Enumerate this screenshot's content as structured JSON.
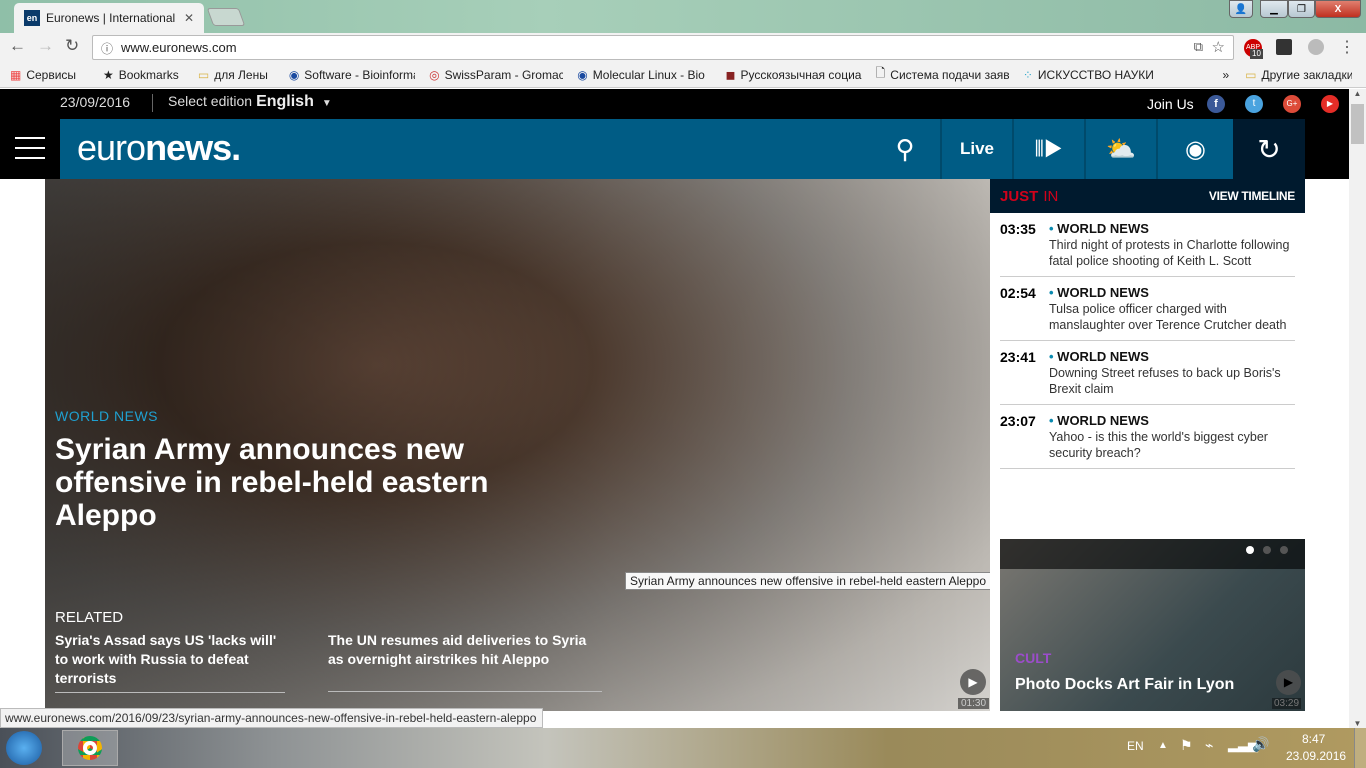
{
  "browser": {
    "tab_title": "Euronews | International",
    "tab_favicon": "en",
    "url": "www.euronews.com",
    "bookmarks": [
      {
        "icon": "apps",
        "label": "Сервисы"
      },
      {
        "icon": "star",
        "label": "Bookmarks"
      },
      {
        "icon": "folder",
        "label": "для Лены"
      },
      {
        "icon": "dna",
        "label": "Software - Bioinforma"
      },
      {
        "icon": "swissparam",
        "label": "SwissParam - Gromac"
      },
      {
        "icon": "dna",
        "label": "Molecular Linux - Bio"
      },
      {
        "icon": "site",
        "label": "Русскоязычная социа"
      },
      {
        "icon": "page",
        "label": "Система подачи заяв"
      },
      {
        "icon": "dots",
        "label": "ИСКУССТВО НАУКИ"
      }
    ],
    "bookmarks_more": "»",
    "other_bookmarks": "Другие закладки",
    "abp_count": "10",
    "status_url": "www.euronews.com/2016/09/23/syrian-army-announces-new-offensive-in-rebel-held-eastern-aleppo"
  },
  "site": {
    "date": "23/09/2016",
    "select_edition": "Select edition",
    "edition": "English",
    "join_us": "Join Us",
    "logo_light": "euro",
    "logo_bold": "news.",
    "live": "Live",
    "colors": {
      "nav": "#005c85",
      "dark": "#001a2e",
      "accent_red": "#d0021b",
      "world_news": "#0a8ab0",
      "cult": "#9b4dca"
    }
  },
  "hero": {
    "category": "WORLD NEWS",
    "headline": "Syrian Army announces new offensive in rebel-held eastern Aleppo",
    "tooltip": "Syrian Army announces new offensive in rebel-held eastern Aleppo",
    "duration": "01:30",
    "related_label": "RELATED",
    "related": [
      "Syria's Assad says US 'lacks will' to work with Russia to defeat terrorists",
      "The UN resumes aid deliveries to Syria as overnight airstrikes hit Aleppo"
    ]
  },
  "just_in": {
    "title_bold": "JUST",
    "title_light": "IN",
    "view_timeline": "VIEW TIMELINE",
    "items": [
      {
        "time": "03:35",
        "category": "WORLD NEWS",
        "headline": "Third night of protests in Charlotte following fatal police shooting of Keith L. Scott"
      },
      {
        "time": "02:54",
        "category": "WORLD NEWS",
        "headline": "Tulsa police officer charged with manslaughter over Terence Crutcher death"
      },
      {
        "time": "23:41",
        "category": "WORLD NEWS",
        "headline": "Downing Street refuses to back up Boris's Brexit claim"
      },
      {
        "time": "23:07",
        "category": "WORLD NEWS",
        "headline": "Yahoo - is this the world's biggest cyber security breach?"
      }
    ]
  },
  "promo": {
    "category": "CULT",
    "headline": "Photo Docks Art Fair in Lyon",
    "duration": "03:29",
    "slides": 3,
    "active_slide": 1
  },
  "taskbar": {
    "lang": "EN",
    "time": "8:47",
    "date": "23.09.2016"
  }
}
